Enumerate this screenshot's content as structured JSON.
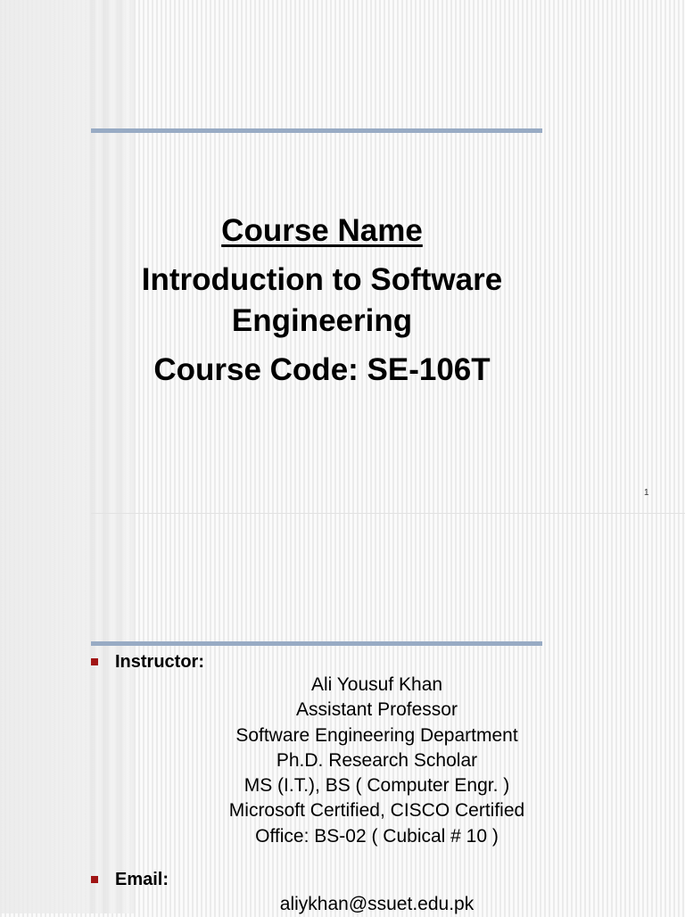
{
  "slide1": {
    "heading": "Course Name",
    "course_title_line1": "Introduction to Software",
    "course_title_line2": "Engineering",
    "course_code": "Course Code: SE-106T",
    "page_number": "1"
  },
  "slide2": {
    "instructor_label": "Instructor:",
    "instructor_details": [
      "Ali Yousuf Khan",
      "Assistant Professor",
      "Software Engineering Department",
      "Ph.D. Research Scholar",
      "MS (I.T.), BS ( Computer Engr. )",
      "Microsoft Certified, CISCO Certified",
      "Office:  BS-02 ( Cubical # 10 )"
    ],
    "email_label": "Email:",
    "email": "aliykhan@ssuet.edu.pk"
  },
  "colors": {
    "rule": "#98abc4",
    "bullet": "#a01414"
  }
}
